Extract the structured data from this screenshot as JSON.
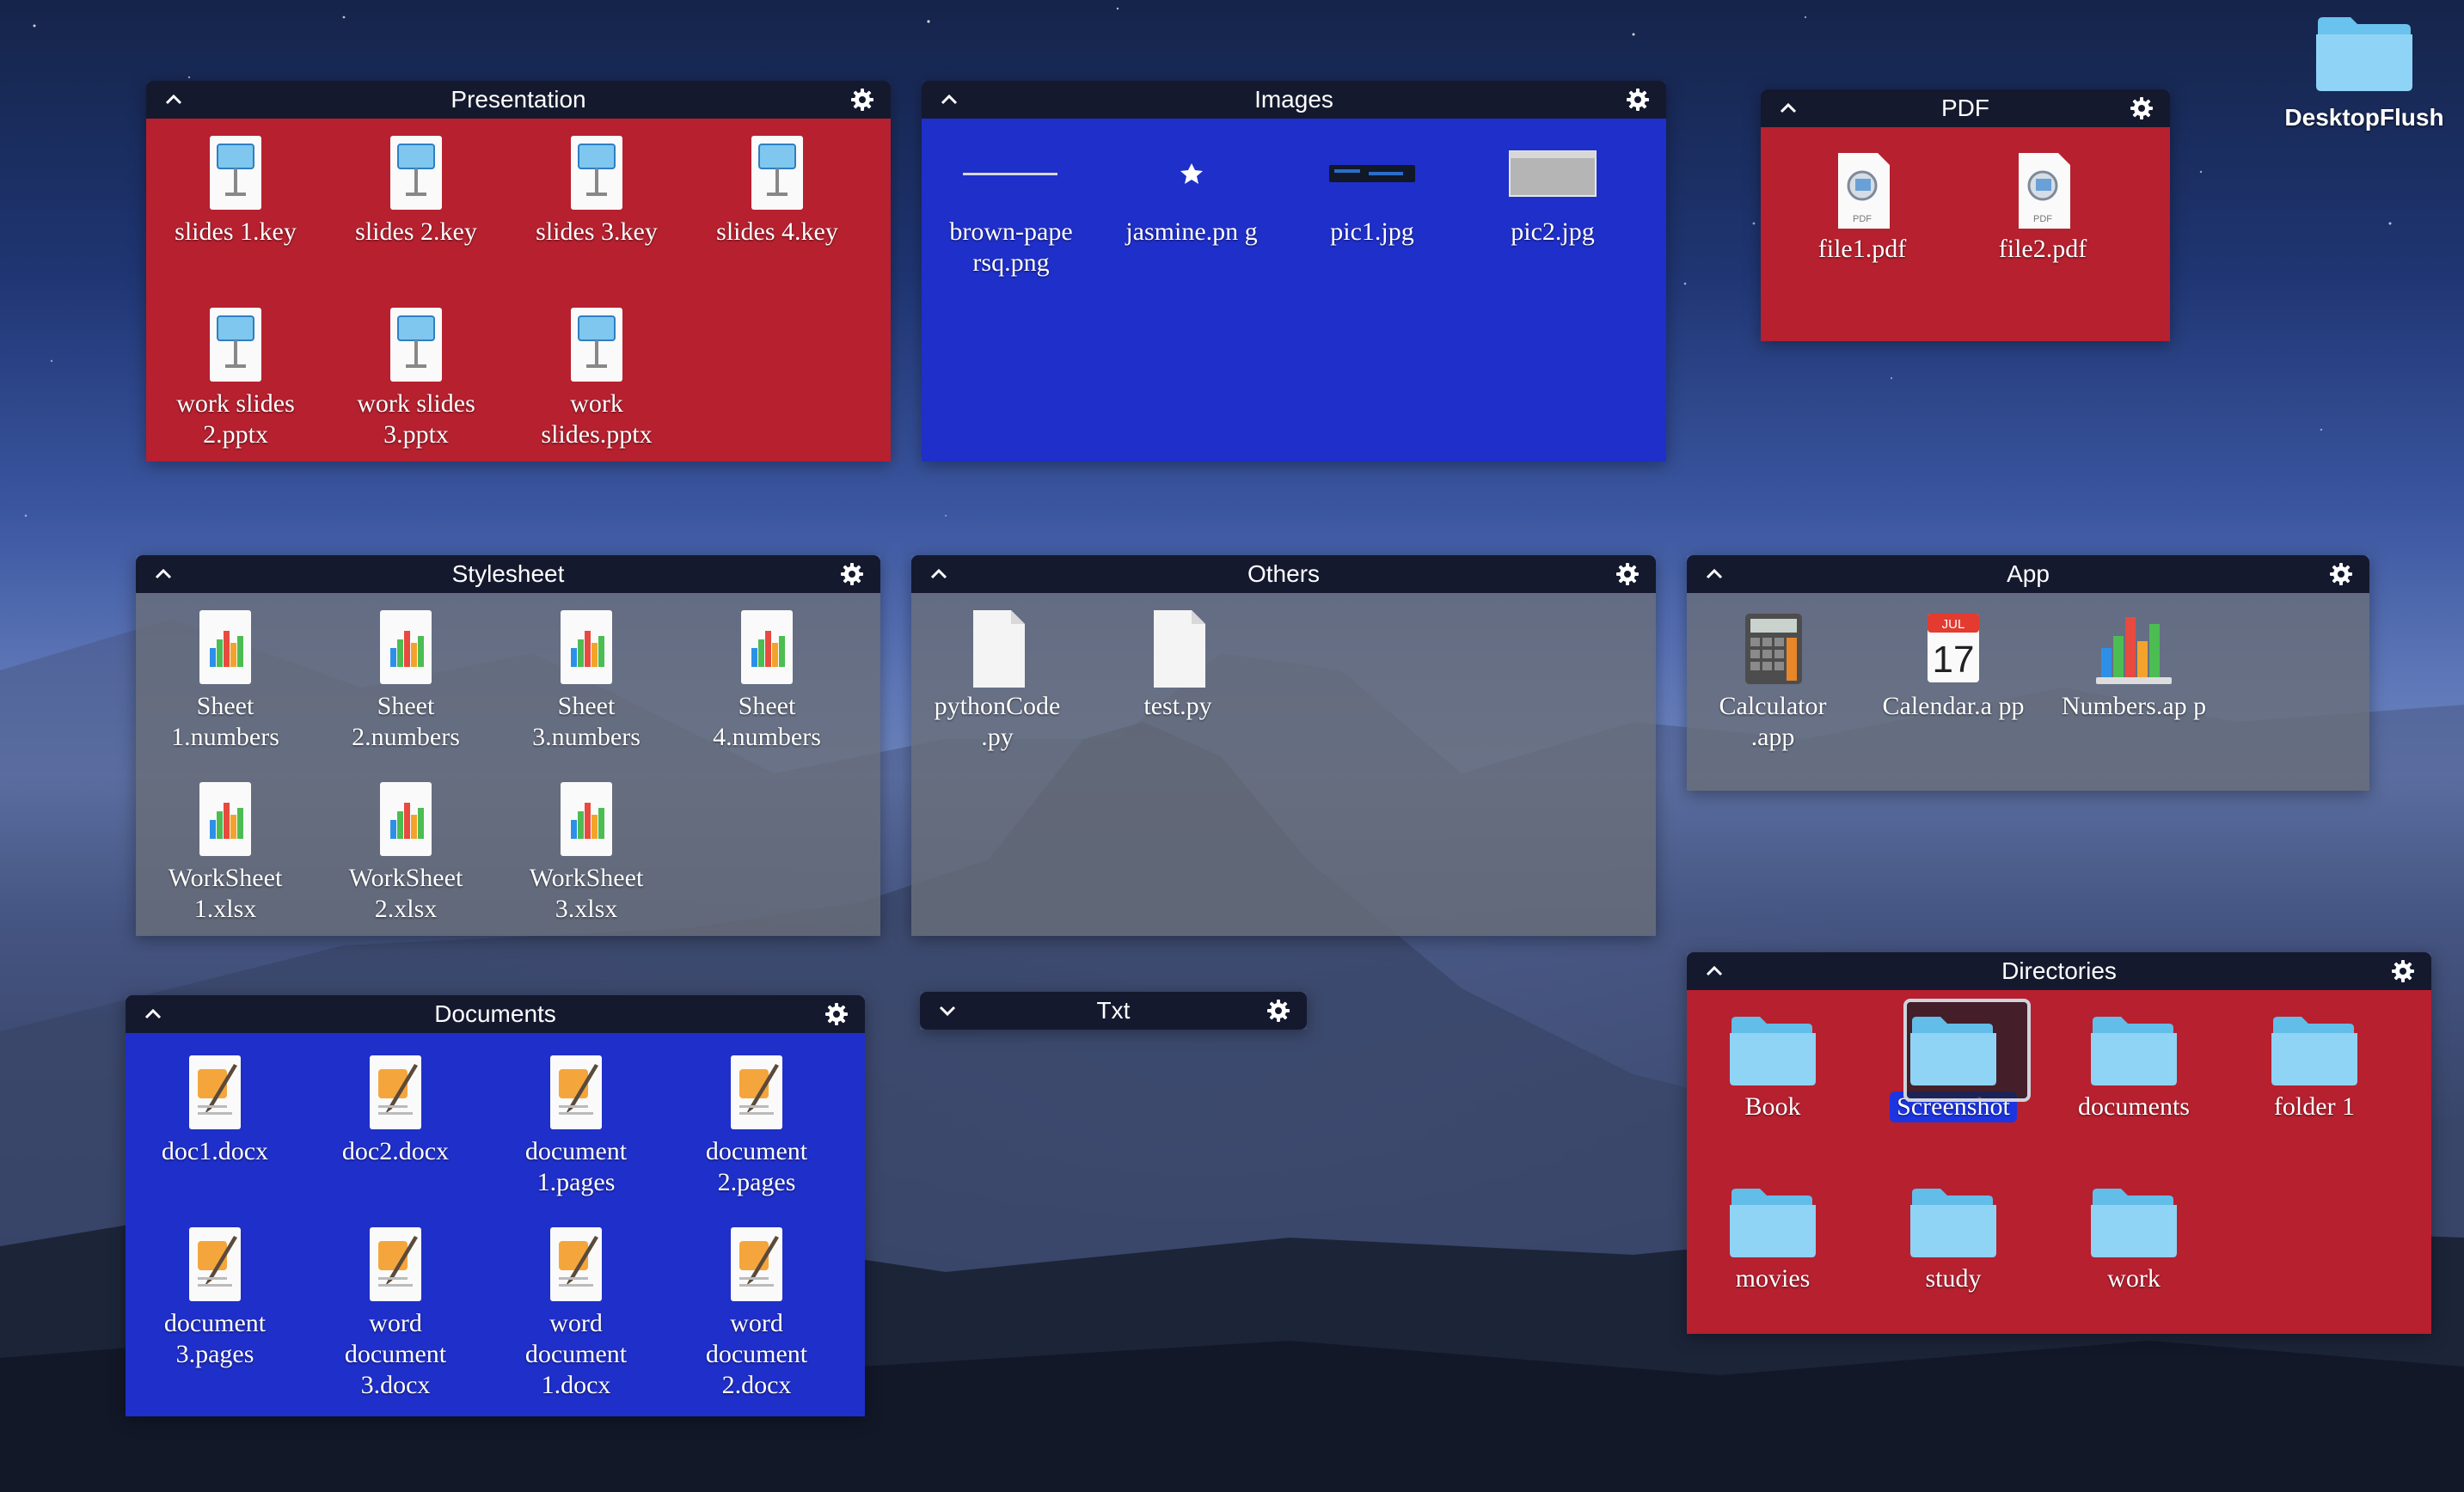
{
  "desktop": {
    "folder_label": "DesktopFlush"
  },
  "colors": {
    "red": "#b6202f",
    "blue": "#1f2fc9",
    "header": "#15192e",
    "selection": "#1d35e0"
  },
  "stacks": {
    "presentation": {
      "title": "Presentation",
      "state": "expanded",
      "items": [
        "slides 1.key",
        "slides 2.key",
        "slides 3.key",
        "slides 4.key",
        "work slides 2.pptx",
        "work slides 3.pptx",
        "work slides.pptx"
      ]
    },
    "images": {
      "title": "Images",
      "state": "expanded",
      "items": [
        "brown-pape rsq.png",
        "jasmine.pn g",
        "pic1.jpg",
        "pic2.jpg"
      ]
    },
    "pdf": {
      "title": "PDF",
      "state": "expanded",
      "items": [
        "file1.pdf",
        "file2.pdf"
      ]
    },
    "stylesheet": {
      "title": "Stylesheet",
      "state": "expanded",
      "items": [
        "Sheet 1.numbers",
        "Sheet 2.numbers",
        "Sheet 3.numbers",
        "Sheet 4.numbers",
        "WorkSheet 1.xlsx",
        "WorkSheet 2.xlsx",
        "WorkSheet 3.xlsx"
      ]
    },
    "others": {
      "title": "Others",
      "state": "expanded",
      "items": [
        "pythonCode .py",
        "test.py"
      ]
    },
    "app": {
      "title": "App",
      "state": "expanded",
      "items": [
        "Calculator .app",
        "Calendar.a pp",
        "Numbers.ap p"
      ],
      "calendar_month": "JUL",
      "calendar_day": "17"
    },
    "documents": {
      "title": "Documents",
      "state": "expanded",
      "items": [
        "doc1.docx",
        "doc2.docx",
        "document 1.pages",
        "document 2.pages",
        "document 3.pages",
        "word document 3.docx",
        "word document 1.docx",
        "word document 2.docx"
      ]
    },
    "txt": {
      "title": "Txt",
      "state": "collapsed"
    },
    "directories": {
      "title": "Directories",
      "state": "expanded",
      "items": [
        "Book",
        "Screenshot",
        "documents",
        "folder 1",
        "movies",
        "study",
        "work"
      ],
      "selected": "Screenshot"
    }
  },
  "icons": {
    "header_left": "chevron-up-icon",
    "header_left_collapsed": "chevron-down-icon",
    "header_right": "gear-icon"
  }
}
